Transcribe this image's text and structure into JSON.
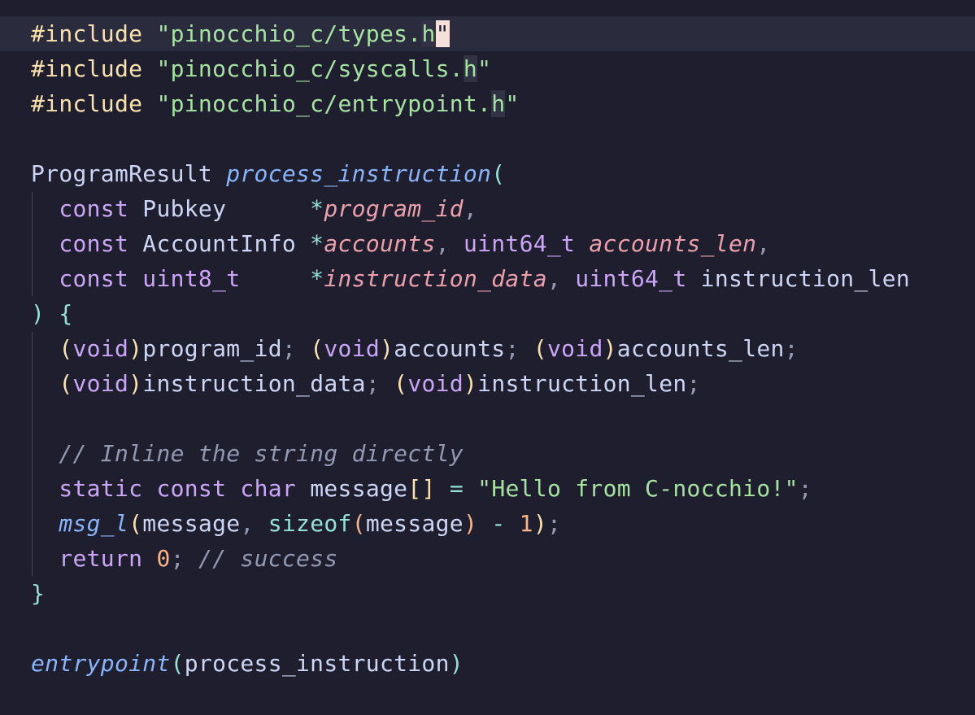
{
  "colors": {
    "background": "#1e1e2e",
    "text": "#cdd6f4",
    "keyword": "#cba6f7",
    "string": "#a6e3a1",
    "preprocessor": "#f9e2af",
    "function": "#89b4fa",
    "parameter": "#eba0ac",
    "operator": "#94e2d5",
    "number": "#fab387",
    "comment": "#9399b2",
    "paren": "#f9e2af",
    "punctuation": "#9399b2"
  },
  "lines": [
    [
      {
        "t": "#include",
        "c": "preprocessor"
      },
      {
        "t": " ",
        "c": "text"
      },
      {
        "t": "\"pinocchio_c/types.",
        "c": "string"
      },
      {
        "t": "h",
        "c": "string",
        "x": "bracket-hl"
      },
      {
        "t": "\"",
        "c": "string",
        "x": "cursor"
      }
    ],
    [
      {
        "t": "#include",
        "c": "preprocessor"
      },
      {
        "t": " ",
        "c": "text"
      },
      {
        "t": "\"pinocchio_c/syscalls.",
        "c": "string"
      },
      {
        "t": "h",
        "c": "string",
        "x": "bracket-hl"
      },
      {
        "t": "\"",
        "c": "string"
      }
    ],
    [
      {
        "t": "#include",
        "c": "preprocessor"
      },
      {
        "t": " ",
        "c": "text"
      },
      {
        "t": "\"pinocchio_c/entrypoint.",
        "c": "string"
      },
      {
        "t": "h",
        "c": "string",
        "x": "bracket-hl"
      },
      {
        "t": "\"",
        "c": "string"
      }
    ],
    [],
    [
      {
        "t": "ProgramResult ",
        "c": "text"
      },
      {
        "t": "process_instruction",
        "c": "function",
        "i": true
      },
      {
        "t": "(",
        "c": "operator"
      }
    ],
    [
      {
        "t": "  ",
        "c": "text"
      },
      {
        "t": "const",
        "c": "keyword"
      },
      {
        "t": " Pubkey      ",
        "c": "text"
      },
      {
        "t": "*",
        "c": "operator"
      },
      {
        "t": "program_id",
        "c": "parameter",
        "i": true
      },
      {
        "t": ",",
        "c": "punctuation"
      }
    ],
    [
      {
        "t": "  ",
        "c": "text"
      },
      {
        "t": "const",
        "c": "keyword"
      },
      {
        "t": " AccountInfo ",
        "c": "text"
      },
      {
        "t": "*",
        "c": "operator"
      },
      {
        "t": "accounts",
        "c": "parameter",
        "i": true
      },
      {
        "t": ", ",
        "c": "punctuation"
      },
      {
        "t": "uint64_t",
        "c": "keyword"
      },
      {
        "t": " ",
        "c": "text"
      },
      {
        "t": "accounts_len",
        "c": "parameter",
        "i": true
      },
      {
        "t": ",",
        "c": "punctuation"
      }
    ],
    [
      {
        "t": "  ",
        "c": "text"
      },
      {
        "t": "const",
        "c": "keyword"
      },
      {
        "t": " ",
        "c": "text"
      },
      {
        "t": "uint8_t",
        "c": "keyword"
      },
      {
        "t": "     ",
        "c": "text"
      },
      {
        "t": "*",
        "c": "operator"
      },
      {
        "t": "instruction_data",
        "c": "parameter",
        "i": true
      },
      {
        "t": ", ",
        "c": "punctuation"
      },
      {
        "t": "uint64_t",
        "c": "keyword"
      },
      {
        "t": " instruction_len",
        "c": "text"
      }
    ],
    [
      {
        "t": ")",
        "c": "operator"
      },
      {
        "t": " ",
        "c": "text"
      },
      {
        "t": "{",
        "c": "operator"
      }
    ],
    [
      {
        "t": "  ",
        "c": "text"
      },
      {
        "t": "(",
        "c": "paren"
      },
      {
        "t": "void",
        "c": "keyword"
      },
      {
        "t": ")",
        "c": "paren"
      },
      {
        "t": "program_id",
        "c": "text"
      },
      {
        "t": "; ",
        "c": "punctuation"
      },
      {
        "t": "(",
        "c": "paren"
      },
      {
        "t": "void",
        "c": "keyword"
      },
      {
        "t": ")",
        "c": "paren"
      },
      {
        "t": "accounts",
        "c": "text"
      },
      {
        "t": "; ",
        "c": "punctuation"
      },
      {
        "t": "(",
        "c": "paren"
      },
      {
        "t": "void",
        "c": "keyword"
      },
      {
        "t": ")",
        "c": "paren"
      },
      {
        "t": "accounts_len",
        "c": "text"
      },
      {
        "t": ";",
        "c": "punctuation"
      }
    ],
    [
      {
        "t": "  ",
        "c": "text"
      },
      {
        "t": "(",
        "c": "paren"
      },
      {
        "t": "void",
        "c": "keyword"
      },
      {
        "t": ")",
        "c": "paren"
      },
      {
        "t": "instruction_data",
        "c": "text"
      },
      {
        "t": "; ",
        "c": "punctuation"
      },
      {
        "t": "(",
        "c": "paren"
      },
      {
        "t": "void",
        "c": "keyword"
      },
      {
        "t": ")",
        "c": "paren"
      },
      {
        "t": "instruction_len",
        "c": "text"
      },
      {
        "t": ";",
        "c": "punctuation"
      }
    ],
    [],
    [
      {
        "t": "  ",
        "c": "text"
      },
      {
        "t": "// Inline the string directly",
        "c": "comment",
        "i": true
      }
    ],
    [
      {
        "t": "  ",
        "c": "text"
      },
      {
        "t": "static",
        "c": "keyword"
      },
      {
        "t": " ",
        "c": "text"
      },
      {
        "t": "const",
        "c": "keyword"
      },
      {
        "t": " ",
        "c": "text"
      },
      {
        "t": "char",
        "c": "keyword"
      },
      {
        "t": " message",
        "c": "text"
      },
      {
        "t": "[]",
        "c": "paren"
      },
      {
        "t": " ",
        "c": "text"
      },
      {
        "t": "=",
        "c": "operator"
      },
      {
        "t": " ",
        "c": "text"
      },
      {
        "t": "\"Hello from C-nocchio!\"",
        "c": "string"
      },
      {
        "t": ";",
        "c": "punctuation"
      }
    ],
    [
      {
        "t": "  ",
        "c": "text"
      },
      {
        "t": "msg_l",
        "c": "function",
        "i": true
      },
      {
        "t": "(",
        "c": "paren"
      },
      {
        "t": "message",
        "c": "text"
      },
      {
        "t": ", ",
        "c": "punctuation"
      },
      {
        "t": "sizeof",
        "c": "operator"
      },
      {
        "t": "(",
        "c": "number"
      },
      {
        "t": "message",
        "c": "text"
      },
      {
        "t": ")",
        "c": "number"
      },
      {
        "t": " ",
        "c": "text"
      },
      {
        "t": "-",
        "c": "operator"
      },
      {
        "t": " ",
        "c": "text"
      },
      {
        "t": "1",
        "c": "number"
      },
      {
        "t": ")",
        "c": "paren"
      },
      {
        "t": ";",
        "c": "punctuation"
      }
    ],
    [
      {
        "t": "  ",
        "c": "text"
      },
      {
        "t": "return",
        "c": "keyword"
      },
      {
        "t": " ",
        "c": "text"
      },
      {
        "t": "0",
        "c": "number"
      },
      {
        "t": "; ",
        "c": "punctuation"
      },
      {
        "t": "// success",
        "c": "comment",
        "i": true
      }
    ],
    [
      {
        "t": "}",
        "c": "operator"
      }
    ],
    [],
    [
      {
        "t": "entrypoint",
        "c": "function",
        "i": true
      },
      {
        "t": "(",
        "c": "operator"
      },
      {
        "t": "process_instruction",
        "c": "text"
      },
      {
        "t": ")",
        "c": "operator"
      }
    ]
  ]
}
